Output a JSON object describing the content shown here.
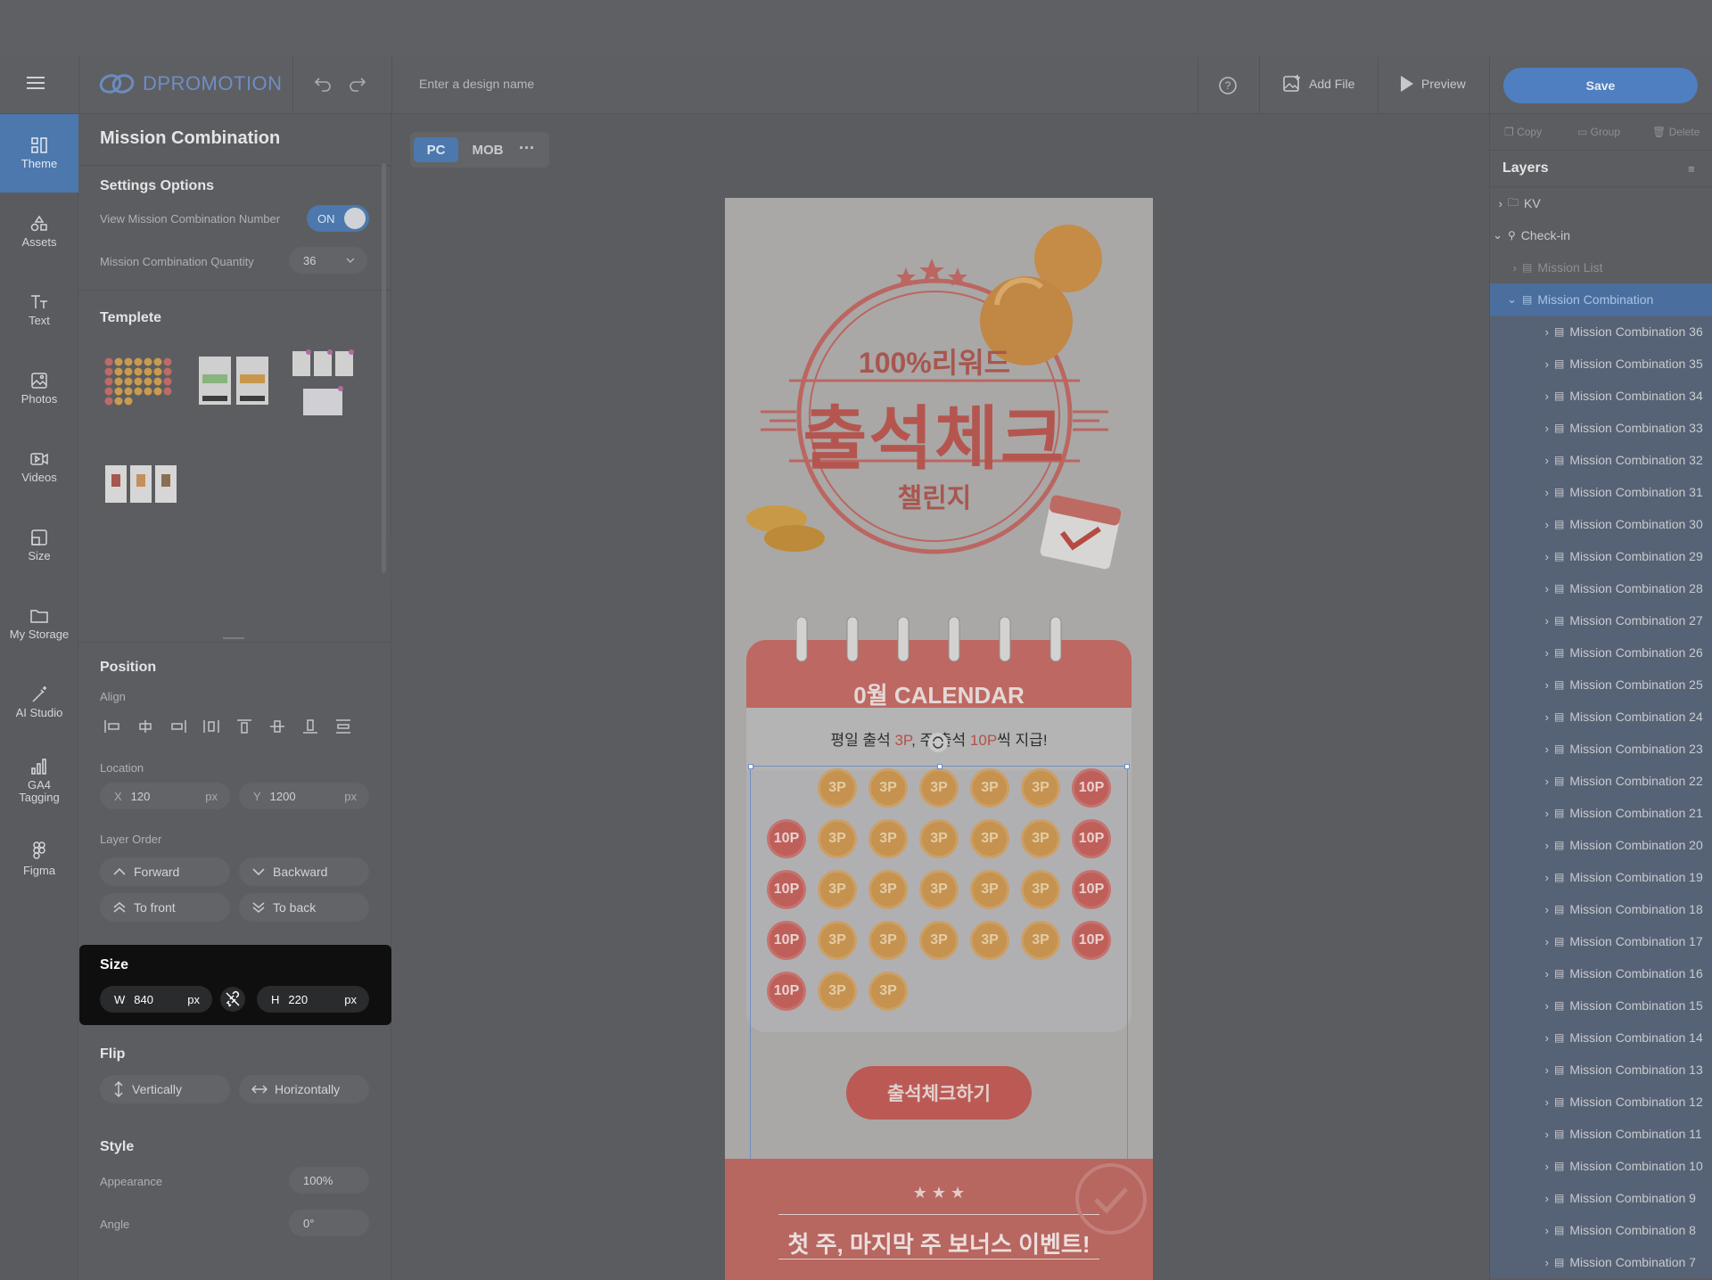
{
  "header": {
    "brand": "DPROMOTION",
    "design_name_placeholder": "Enter a design name",
    "add_file": "Add File",
    "preview": "Preview",
    "save": "Save"
  },
  "nav": [
    {
      "label": "Theme"
    },
    {
      "label": "Assets"
    },
    {
      "label": "Text"
    },
    {
      "label": "Photos"
    },
    {
      "label": "Videos"
    },
    {
      "label": "Size"
    },
    {
      "label": "My Storage"
    },
    {
      "label": "AI Studio"
    },
    {
      "label": "GA4 Tagging"
    },
    {
      "label": "Figma"
    }
  ],
  "panel": {
    "title": "Mission Combination",
    "settings_title": "Settings Options",
    "view_number_label": "View Mission Combination Number",
    "toggle_value": "ON",
    "quantity_label": "Mission Combination Quantity",
    "quantity_value": "36",
    "template_title": "Templete",
    "position_title": "Position",
    "align_label": "Align",
    "location_label": "Location",
    "x_label": "X",
    "x_value": "120",
    "y_label": "Y",
    "y_value": "1200",
    "unit": "px",
    "layer_order_label": "Layer Order",
    "forward": "Forward",
    "backward": "Backward",
    "to_front": "To front",
    "to_back": "To back",
    "size_title": "Size",
    "w_label": "W",
    "w_value": "840",
    "h_label": "H",
    "h_value": "220",
    "flip_title": "Flip",
    "vertically": "Vertically",
    "horizontally": "Horizontally",
    "style_title": "Style",
    "appearance_label": "Appearance",
    "appearance_value": "100%",
    "angle_label": "Angle",
    "angle_value": "0°"
  },
  "canvas": {
    "tab_pc": "PC",
    "tab_mob": "MOB",
    "reward_text": "100%리워드",
    "main_title": "출석체크",
    "challenge": "챌린지",
    "calendar_title": "0월 CALENDAR",
    "notice_prefix": "평일 출석 ",
    "notice_3p": "3P",
    "notice_mid": ", 주",
    "notice_mid2": "출석 ",
    "notice_10p": "10P",
    "notice_suffix": "씩 지급!",
    "coins": [
      [
        "",
        "3P",
        "3P",
        "3P",
        "3P",
        "3P",
        "10P"
      ],
      [
        "10P",
        "3P",
        "3P",
        "3P",
        "3P",
        "3P",
        "10P"
      ],
      [
        "10P",
        "3P",
        "3P",
        "3P",
        "3P",
        "3P",
        "10P"
      ],
      [
        "10P",
        "3P",
        "3P",
        "3P",
        "3P",
        "3P",
        "10P"
      ],
      [
        "10P",
        "3P",
        "3P",
        "",
        "",
        "",
        ""
      ]
    ],
    "cta": "출석체크하기",
    "bonus": "첫 주, 마지막 주 보너스 이벤트!"
  },
  "layers": {
    "copy": "Copy",
    "group": "Group",
    "delete": "Delete",
    "title": "Layers",
    "items": [
      {
        "label": "KV"
      },
      {
        "label": "Check-in"
      },
      {
        "label": "Mission List"
      },
      {
        "label": "Mission Combination"
      },
      {
        "label": "Mission Combination 36"
      },
      {
        "label": "Mission Combination 35"
      },
      {
        "label": "Mission Combination 34"
      },
      {
        "label": "Mission Combination 33"
      },
      {
        "label": "Mission Combination 32"
      },
      {
        "label": "Mission Combination 31"
      },
      {
        "label": "Mission Combination 30"
      },
      {
        "label": "Mission Combination 29"
      },
      {
        "label": "Mission Combination 28"
      },
      {
        "label": "Mission Combination 27"
      },
      {
        "label": "Mission Combination 26"
      },
      {
        "label": "Mission Combination 25"
      },
      {
        "label": "Mission Combination 24"
      },
      {
        "label": "Mission Combination 23"
      },
      {
        "label": "Mission Combination 22"
      },
      {
        "label": "Mission Combination 21"
      },
      {
        "label": "Mission Combination 20"
      },
      {
        "label": "Mission Combination 19"
      },
      {
        "label": "Mission Combination 18"
      },
      {
        "label": "Mission Combination 17"
      },
      {
        "label": "Mission Combination 16"
      },
      {
        "label": "Mission Combination 15"
      },
      {
        "label": "Mission Combination 14"
      },
      {
        "label": "Mission Combination 13"
      },
      {
        "label": "Mission Combination 12"
      },
      {
        "label": "Mission Combination 11"
      },
      {
        "label": "Mission Combination 10"
      },
      {
        "label": "Mission Combination 9"
      },
      {
        "label": "Mission Combination 8"
      },
      {
        "label": "Mission Combination 7"
      }
    ]
  },
  "colors": {
    "accent": "#4c78ad",
    "save": "#4f7fc0",
    "red": "#c56a66",
    "coin": "#c9964e"
  }
}
